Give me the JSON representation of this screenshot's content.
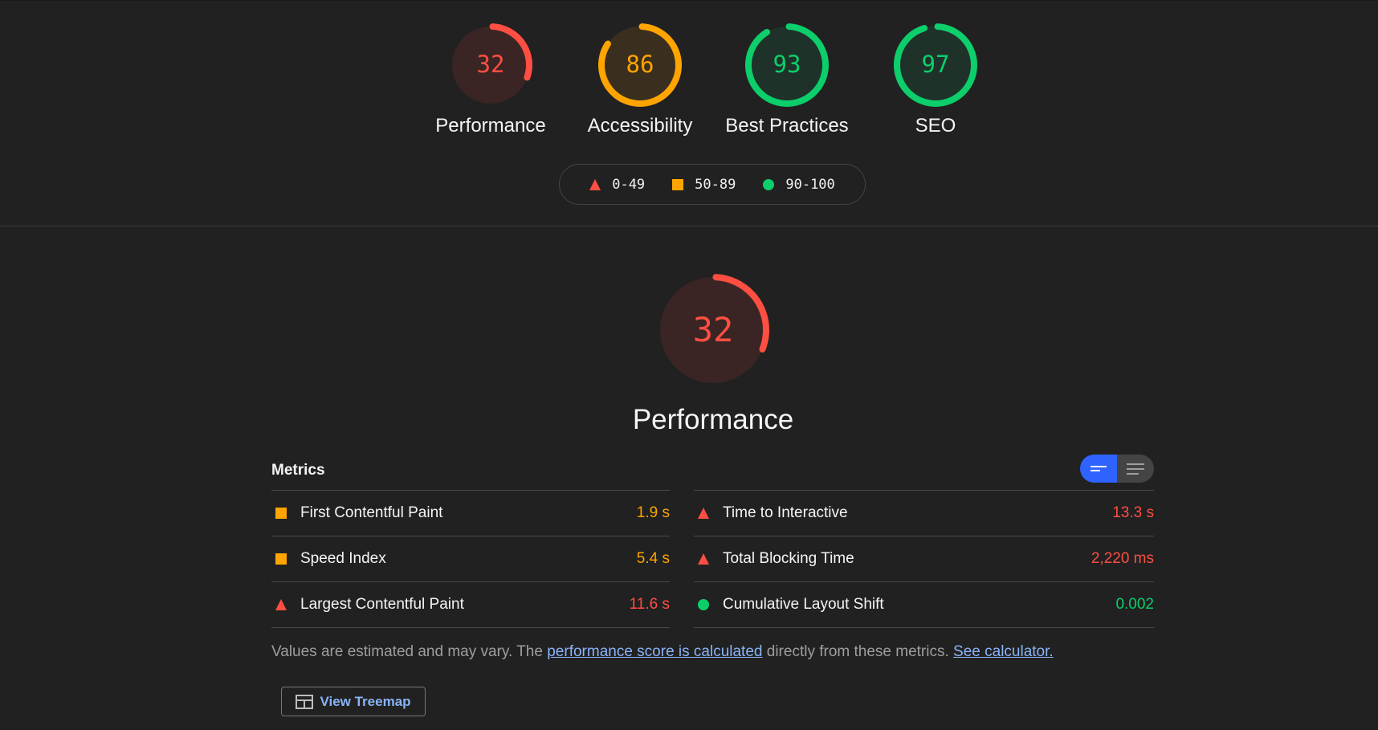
{
  "categories": [
    {
      "id": "performance",
      "label": "Performance",
      "score": 32,
      "rating": "fail"
    },
    {
      "id": "accessibility",
      "label": "Accessibility",
      "score": 86,
      "rating": "average"
    },
    {
      "id": "best-practices",
      "label": "Best Practices",
      "score": 93,
      "rating": "pass"
    },
    {
      "id": "seo",
      "label": "SEO",
      "score": 97,
      "rating": "pass"
    }
  ],
  "legend": {
    "fail": "0-49",
    "average": "50-89",
    "pass": "90-100"
  },
  "colors": {
    "fail": "#ff4e42",
    "average": "#ffa400",
    "pass": "#0cce6b",
    "fail_bg": "#3a2524",
    "average_bg": "#3a2f1e",
    "pass_bg": "#1f3229",
    "accent": "#2e63ff",
    "link": "#8ab4f8"
  },
  "performance": {
    "title": "Performance",
    "score": 32,
    "metrics_title": "Metrics",
    "metrics_left": [
      {
        "label": "First Contentful Paint",
        "value": "1.9 s",
        "rating": "average"
      },
      {
        "label": "Speed Index",
        "value": "5.4 s",
        "rating": "average"
      },
      {
        "label": "Largest Contentful Paint",
        "value": "11.6 s",
        "rating": "fail"
      }
    ],
    "metrics_right": [
      {
        "label": "Time to Interactive",
        "value": "13.3 s",
        "rating": "fail"
      },
      {
        "label": "Total Blocking Time",
        "value": "2,220 ms",
        "rating": "fail"
      },
      {
        "label": "Cumulative Layout Shift",
        "value": "0.002",
        "rating": "pass"
      }
    ],
    "footnote": {
      "text1": "Values are estimated and may vary. The ",
      "link1": "performance score is calculated",
      "text2": " directly from these metrics. ",
      "link2": "See calculator."
    },
    "treemap_button": "View Treemap"
  }
}
